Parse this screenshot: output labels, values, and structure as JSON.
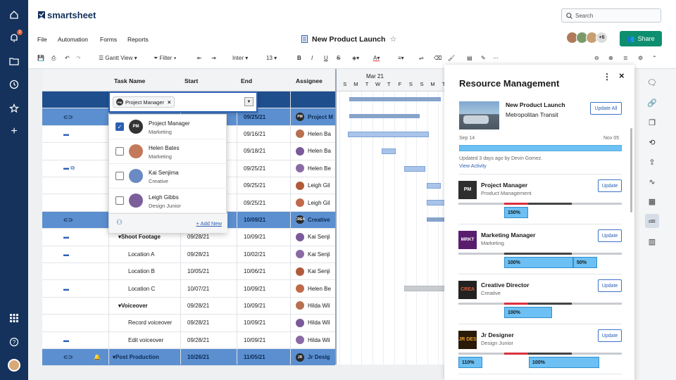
{
  "app": {
    "name": "smartsheet",
    "notif_count": "3"
  },
  "search": {
    "placeholder": "Search"
  },
  "menu": [
    "File",
    "Automation",
    "Forms",
    "Reports"
  ],
  "sheet": {
    "title": "New Product Launch",
    "extra_users": "+6",
    "share_label": "Share"
  },
  "toolbar": {
    "view": "Gantt View",
    "filter": "Filter",
    "font": "Inter",
    "size": "13"
  },
  "grid": {
    "headers": [
      "Task Name",
      "Start",
      "End",
      "Assignee"
    ],
    "rows": [
      {
        "task": "",
        "start": "",
        "end": "/21",
        "assignee": "",
        "parent": true,
        "icon": ""
      },
      {
        "task": "",
        "start": "",
        "end": "09/25/21",
        "assignee": "Project M",
        "parent": true,
        "icon": "link",
        "av": "PM"
      },
      {
        "task": "",
        "start": "",
        "end": "09/16/21",
        "assignee": "Helen Ba",
        "icon": "comment"
      },
      {
        "task": "",
        "start": "",
        "end": "09/18/21",
        "assignee": "Helen Ba",
        "icon": ""
      },
      {
        "task": "",
        "start": "",
        "end": "09/25/21",
        "assignee": "Helen Be",
        "icon": "comment-attach"
      },
      {
        "task": "",
        "start": "",
        "end": "09/25/21",
        "assignee": "Leigh Gil",
        "icon": ""
      },
      {
        "task": "",
        "start": "",
        "end": "09/25/21",
        "assignee": "Leigh Gil",
        "icon": ""
      },
      {
        "task": "",
        "start": "10/09/21",
        "end": "10/09/21",
        "assignee": "Creative",
        "parent": true,
        "icon": "link",
        "av": "CREA"
      },
      {
        "task": "Shoot Footage",
        "start": "09/28/21",
        "end": "10/09/21",
        "assignee": "Kai Senji",
        "icon": "comment",
        "sub": true
      },
      {
        "task": "Location A",
        "start": "09/28/21",
        "end": "10/02/21",
        "assignee": "Kai Senji",
        "icon": "comment"
      },
      {
        "task": "Location B",
        "start": "10/05/21",
        "end": "10/06/21",
        "assignee": "Kai Senji",
        "icon": ""
      },
      {
        "task": "Location C",
        "start": "10/07/21",
        "end": "10/09/21",
        "assignee": "Helen Be",
        "icon": "comment"
      },
      {
        "task": "Voiceover",
        "start": "09/28/21",
        "end": "10/09/21",
        "assignee": "Hilda Wil",
        "icon": "",
        "sub": true
      },
      {
        "task": "Record voiceover",
        "start": "09/28/21",
        "end": "10/09/21",
        "assignee": "Hilda Wil",
        "icon": ""
      },
      {
        "task": "Edit voiceover",
        "start": "09/28/21",
        "end": "10/09/21",
        "assignee": "Hilda Wil",
        "icon": "comment"
      },
      {
        "task": "Post Production",
        "start": "10/26/21",
        "end": "11/05/21",
        "assignee": "Jr Desig",
        "parent": true,
        "icon": "link",
        "av": "JR"
      }
    ]
  },
  "gantt": {
    "month": "Mar 21",
    "days": [
      "S",
      "M",
      "T",
      "W",
      "T",
      "F",
      "S",
      "S",
      "M",
      "T"
    ]
  },
  "dropdown": {
    "chip": "Project Manager",
    "items": [
      {
        "name": "Project Manager",
        "role": "Marketing",
        "checked": true,
        "av": "PM"
      },
      {
        "name": "Helen Bates",
        "role": "Marketing",
        "checked": false
      },
      {
        "name": "Kai Senjima",
        "role": "Creative",
        "checked": false
      },
      {
        "name": "Leigh Gibbs",
        "role": "Design Junior",
        "checked": false
      }
    ],
    "add_new": "+ Add New"
  },
  "panel": {
    "title": "Resource Management",
    "project": "New Product Launch",
    "client": "Metropolitan Transit",
    "update_all": "Update All",
    "date_start": "Sep 14",
    "date_end": "Nov 05",
    "updated": "Updated 3 days ago by Devin Gomez.",
    "view_activity": "View Activity",
    "update_label": "Update",
    "resources": [
      {
        "badge": "PM",
        "name": "Project Manager",
        "role": "Product Management",
        "pills": [
          "150%"
        ],
        "color": "#2e2e2e"
      },
      {
        "badge": "MRKT",
        "name": "Marketing Manager",
        "role": "Marketing",
        "pills": [
          "100%",
          "50%"
        ],
        "color": "#5a1d6e"
      },
      {
        "badge": "CREA",
        "name": "Creative Director",
        "role": "Creative",
        "pills": [
          "100%"
        ],
        "color": "#222"
      },
      {
        "badge": "JR DES",
        "name": "Jr Designer",
        "role": "Design Junior",
        "pills": [
          "110%",
          "100%"
        ],
        "color": "#2a1a0a"
      }
    ]
  }
}
